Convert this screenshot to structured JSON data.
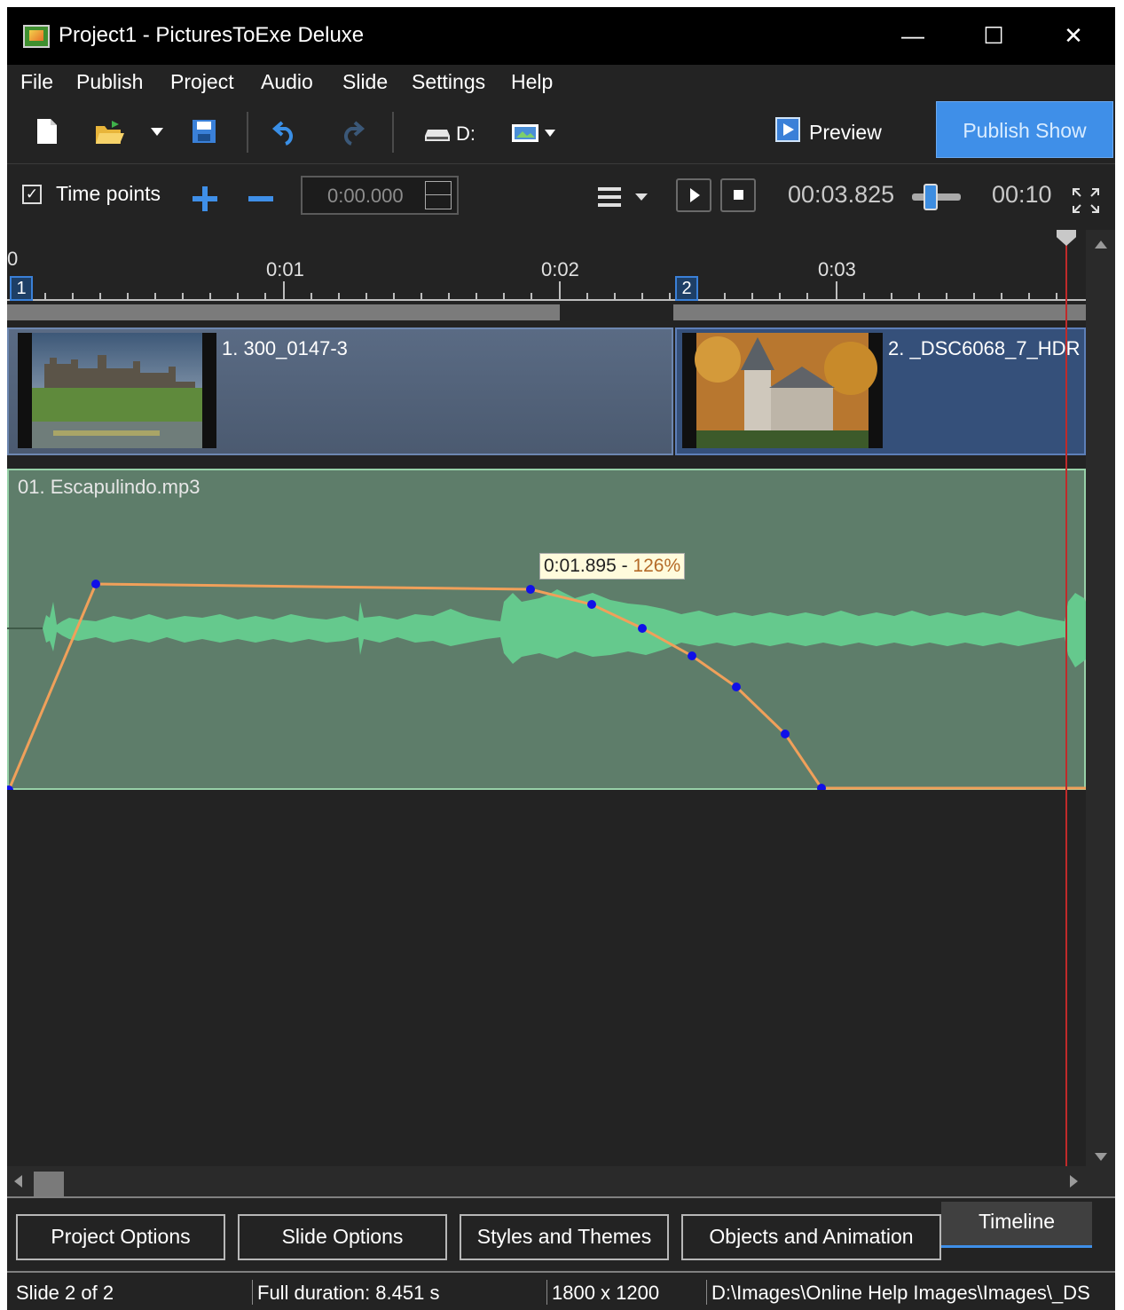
{
  "window": {
    "title": "Project1 - PicturesToExe Deluxe",
    "controls": {
      "minimize": "—",
      "maximize": "☐",
      "close": "✕"
    }
  },
  "menu": [
    "File",
    "Publish",
    "Project",
    "Audio",
    "Slide",
    "Settings",
    "Help"
  ],
  "toolbar": {
    "drive_label": "D:",
    "preview_label": "Preview",
    "publish_label": "Publish Show",
    "icons": [
      "new-project-icon",
      "open-folder-icon",
      "dropdown-arrow-icon",
      "save-icon",
      "undo-icon",
      "redo-icon",
      "drive-icon",
      "image-view-icon"
    ]
  },
  "timeline_toolbar": {
    "time_points_checked": true,
    "time_points_label": "Time points",
    "time_input": "0:00.000",
    "current_position": "00:03.825",
    "visible_duration": "00:10",
    "icons": [
      "add-icon",
      "remove-icon",
      "list-menu-icon",
      "play-icon",
      "stop-icon",
      "zoom-slider",
      "fullscreen-icon"
    ]
  },
  "ruler": {
    "labels": [
      "0",
      "0:01",
      "0:02",
      "0:03"
    ],
    "slide_markers": [
      "1",
      "2"
    ]
  },
  "slides": [
    {
      "number": "1",
      "label": "1. 300_0147-3"
    },
    {
      "number": "2",
      "label": "2. _DSC6068_7_HDR"
    }
  ],
  "audio": {
    "track_label": "01. Escapulindo.mp3",
    "tooltip_time": "0:01.895",
    "tooltip_sep": " - ",
    "tooltip_value": "126%",
    "envelope_color": "#f0a05a",
    "point_color": "#1010e8",
    "waveform_color": "#65c98d"
  },
  "tabs": [
    "Project Options",
    "Slide Options",
    "Styles and Themes",
    "Objects and Animation",
    "Timeline"
  ],
  "active_tab": "Timeline",
  "status": {
    "slide": "Slide 2 of 2",
    "duration": "Full duration: 8.451 s",
    "resolution": "1800 x 1200",
    "path": "D:\\Images\\Online Help Images\\Images\\_DS"
  },
  "colors": {
    "accent": "#3f8fe8",
    "playhead": "#c02a2a"
  }
}
